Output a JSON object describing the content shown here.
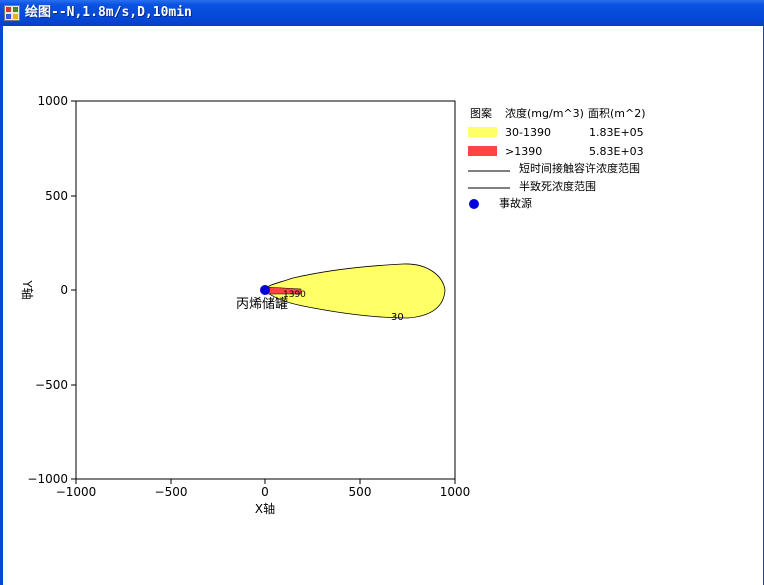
{
  "window": {
    "title": "绘图--N,1.8m/s,D,10min",
    "icon": "app-window-icon"
  },
  "plot": {
    "y_axis_label": "Y轴",
    "x_axis_label": "X轴",
    "x_ticks": [
      "−1000",
      "−500",
      "0",
      "500",
      "1000"
    ],
    "y_ticks": [
      "1000",
      "500",
      "0",
      "−500",
      "−1000"
    ],
    "xlim": [
      -1000,
      1000
    ],
    "ylim": [
      -1000,
      1000
    ],
    "source_label": "丙烯储罐",
    "contour_label_high": "1390",
    "contour_label_low": "30",
    "colors": {
      "low_zone": "#ffff66",
      "high_zone": "#ff4444",
      "source": "#0000dd",
      "outline": "#000000"
    }
  },
  "legend": {
    "header_pattern": "图案",
    "header_conc": "浓度(mg/m^3)",
    "header_area": "面积(m^2)",
    "rows": [
      {
        "range": "30-1390",
        "area": "1.83E+05",
        "color": "#ffff66"
      },
      {
        "range": ">1390",
        "area": "5.83E+03",
        "color": "#ff4444"
      }
    ],
    "line_short_term": "短时间接触容许浓度范围",
    "line_half_lethal": "半致死浓度范围",
    "source": "事故源"
  }
}
